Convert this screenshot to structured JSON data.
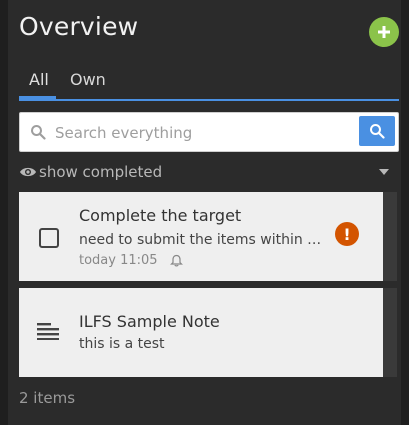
{
  "header": {
    "title": "Overview",
    "add_button_icon": "plus-icon",
    "accent": "#8bc34a"
  },
  "tabs": [
    {
      "label": "All",
      "active": true
    },
    {
      "label": "Own",
      "active": false
    }
  ],
  "search": {
    "placeholder": "Search everything",
    "value": ""
  },
  "filter": {
    "label": "show completed"
  },
  "items": [
    {
      "type": "task",
      "title": "Complete the target",
      "subtitle": "need to submit the items within …",
      "meta": "today 11:05",
      "completed": false,
      "priority_icon": "alert-icon",
      "priority_color": "#d35400"
    },
    {
      "type": "note",
      "title": "ILFS Sample Note",
      "subtitle": "this is a test"
    }
  ],
  "footer": {
    "count_label": "2 items"
  },
  "colors": {
    "accent_blue": "#4a90e2",
    "background": "#2b2b2b"
  }
}
